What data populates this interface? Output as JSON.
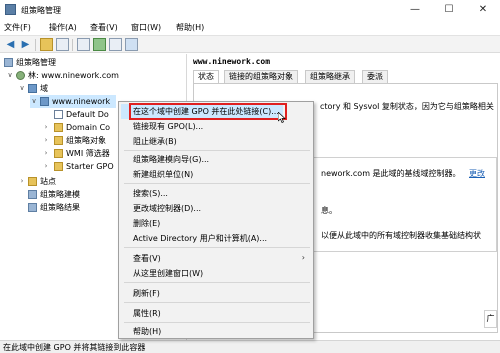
{
  "window": {
    "title": "组策略管理",
    "controls": {
      "minimize": "—",
      "maximize": "☐",
      "close": "✕"
    }
  },
  "menu": [
    "文件(F)",
    "操作(A)",
    "查看(V)",
    "窗口(W)",
    "帮助(H)"
  ],
  "toolbar": {
    "icons": [
      "back-icon",
      "forward-icon",
      "folder-up-icon",
      "view-icon",
      "properties-icon",
      "refresh-icon",
      "export-icon",
      "help-icon"
    ]
  },
  "tree": {
    "root": "组策略管理",
    "forest": "林: www.ninework.com",
    "domains": "域",
    "domain": "www.ninework",
    "children": [
      "Default Do",
      "Domain Co",
      "组策略对象",
      "WMI 筛选器",
      "Starter GPO"
    ],
    "sites": "站点",
    "modeling": "组策略建模",
    "results": "组策略结果"
  },
  "right": {
    "title": "www.ninework.com",
    "tabs": [
      "状态",
      "链接的组策略对象",
      "组策略继承",
      "委派"
    ],
    "line1": "ctory 和 Sysvol 复制状态，因为它与组策略相关",
    "line2a": "nework.com 是此域的基线域控制器。",
    "line2b": "更改",
    "line3": "息。",
    "line4": "以便从此域中的所有域控制器收集基础结构状",
    "btn": "广"
  },
  "context_menu": {
    "items": [
      "在这个域中创建 GPO 并在此处链接(C)...",
      "链接现有 GPO(L)...",
      "阻止继承(B)",
      "组策略建模向导(G)...",
      "新建组织单位(N)",
      "搜索(S)...",
      "更改域控制器(D)...",
      "删除(E)",
      "Active Directory 用户和计算机(A)...",
      "查看(V)",
      "从这里创建窗口(W)",
      "刷新(F)",
      "属性(R)",
      "帮助(H)"
    ],
    "submenu_arrow": "›",
    "highlight_color": "#cce8ff",
    "box_color": "#e02020"
  },
  "status": "在此域中创建 GPO 并将其链接到此容器"
}
